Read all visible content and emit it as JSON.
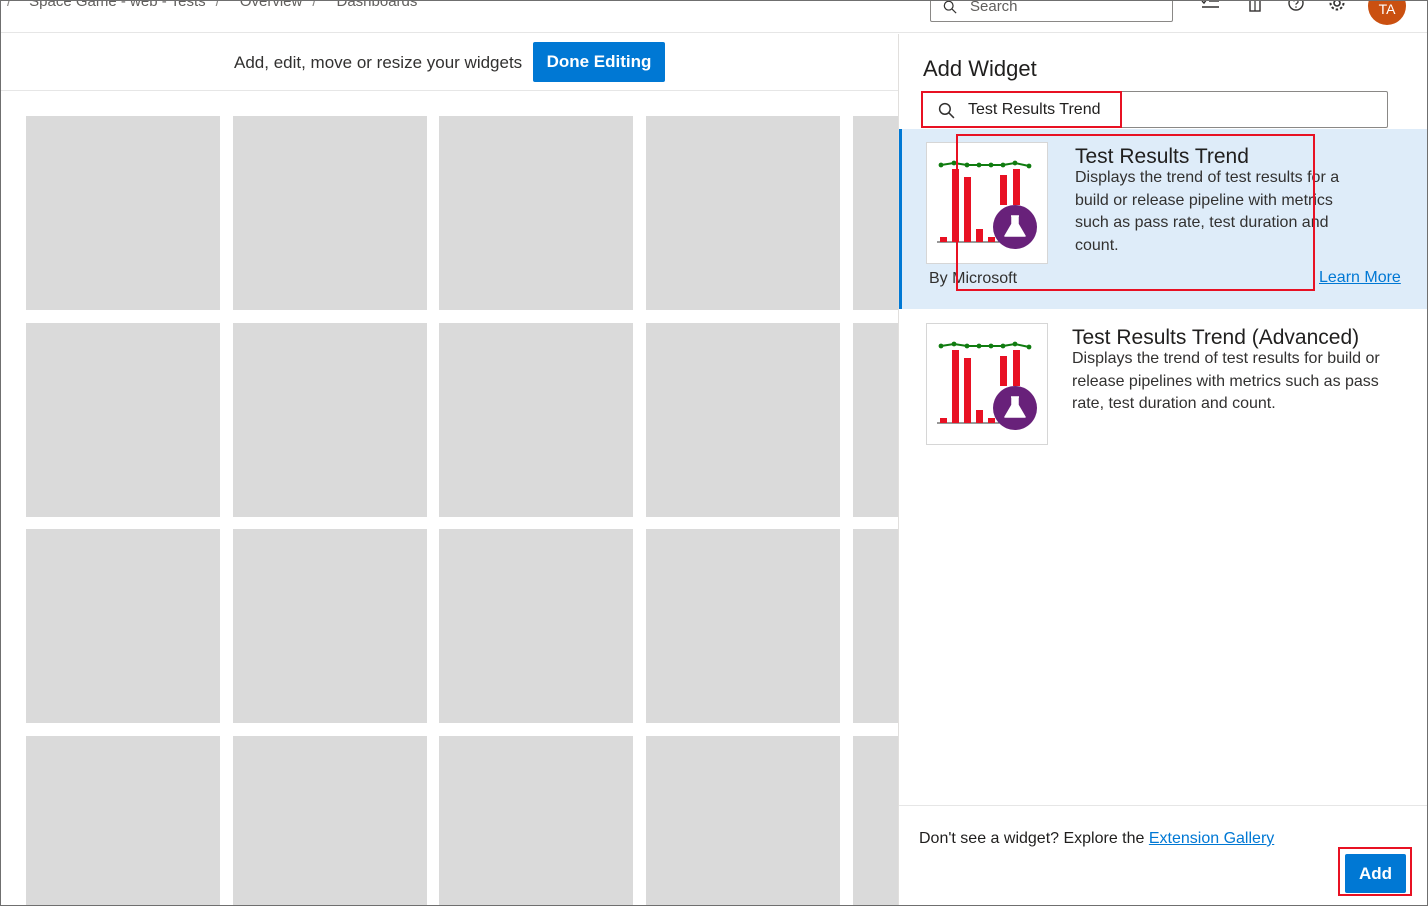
{
  "breadcrumbs": [
    "Space Game - web - Tests",
    "Overview",
    "Dashboards"
  ],
  "topbar": {
    "search_placeholder": "Search",
    "avatar_initials": "TA",
    "icons": [
      "checklist-icon",
      "clipboard-icon",
      "help-icon",
      "settings-icon"
    ]
  },
  "editbar": {
    "message": "Add, edit, move or resize your widgets",
    "done_label": "Done Editing"
  },
  "grid": {
    "rows": 4,
    "columns": 5
  },
  "panel": {
    "title": "Add Widget",
    "search_value": "Test Results Trend",
    "widgets": [
      {
        "title": "Test Results Trend",
        "description": "Displays the trend of test results for a build or release pipeline with metrics such as pass rate, test duration and count.",
        "publisher": "By Microsoft",
        "link": "Learn More",
        "selected": true,
        "icon": "test-results-trend-thumbnail"
      },
      {
        "title": "Test Results Trend (Advanced)",
        "description": "Displays the trend of test results for build or release pipelines with metrics such as pass rate, test duration and count.",
        "selected": false,
        "icon": "test-results-trend-advanced-thumbnail"
      }
    ],
    "footer_message": "Don't see a widget? Explore the",
    "footer_link": "Extension Gallery",
    "add_label": "Add"
  },
  "colors": {
    "accent": "#0078d4",
    "selected_bg": "#deecf9",
    "highlight": "#e81123",
    "avatar": "#ca5010",
    "placeholder_tile": "#dadada",
    "chart_bar": "#e81123",
    "chart_line": "#107c10",
    "flask_badge": "#68217a"
  }
}
